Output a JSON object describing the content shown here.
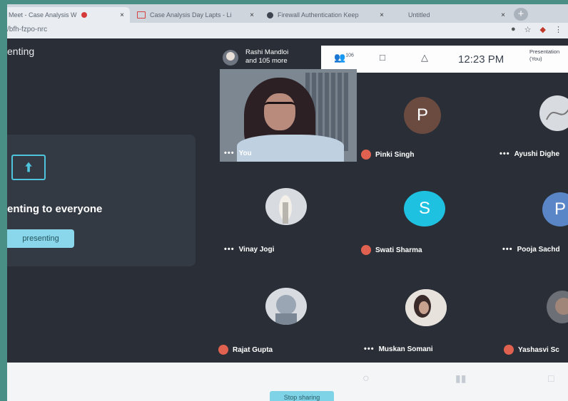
{
  "tabs": [
    {
      "title": "Meet - Case Analysis W",
      "close": "×"
    },
    {
      "title": "Case Analysis Day Lapts - Li",
      "close": "×"
    },
    {
      "title": "Firewall Authentication Keep",
      "close": "×"
    },
    {
      "title": "Untitled",
      "close": "×"
    }
  ],
  "new_tab": "+",
  "address": {
    "url": "/bfh-fzpo-nrc"
  },
  "meet": {
    "presenting_label": "enting",
    "present_message": "enting to everyone",
    "stop_button": "presenting",
    "host": {
      "line1": "Rashi Mandloi",
      "line2": "and 105 more"
    },
    "participants_count": "106",
    "clock": "12:23 PM",
    "presentation_info": {
      "line1": "Presentation",
      "line2": "(You)"
    },
    "participants": [
      {
        "name": "You",
        "initial": "",
        "color": ""
      },
      {
        "name": "Pinki Singh",
        "initial": "P",
        "color": "#6b4a40"
      },
      {
        "name": "Ayushi Dighe",
        "initial": "",
        "color": ""
      },
      {
        "name": "Vinay Jogi",
        "initial": "",
        "color": ""
      },
      {
        "name": "Swati Sharma",
        "initial": "S",
        "color": "#1ec2e0"
      },
      {
        "name": "Pooja Sachd",
        "initial": "P",
        "color": "#5a86c8"
      },
      {
        "name": "Rajat Gupta",
        "initial": "",
        "color": ""
      },
      {
        "name": "Muskan Somani",
        "initial": "",
        "color": ""
      },
      {
        "name": "Yashasvi Sc",
        "initial": "",
        "color": ""
      }
    ],
    "bottom_bar": {
      "stop_button": "Stop sharing"
    }
  }
}
